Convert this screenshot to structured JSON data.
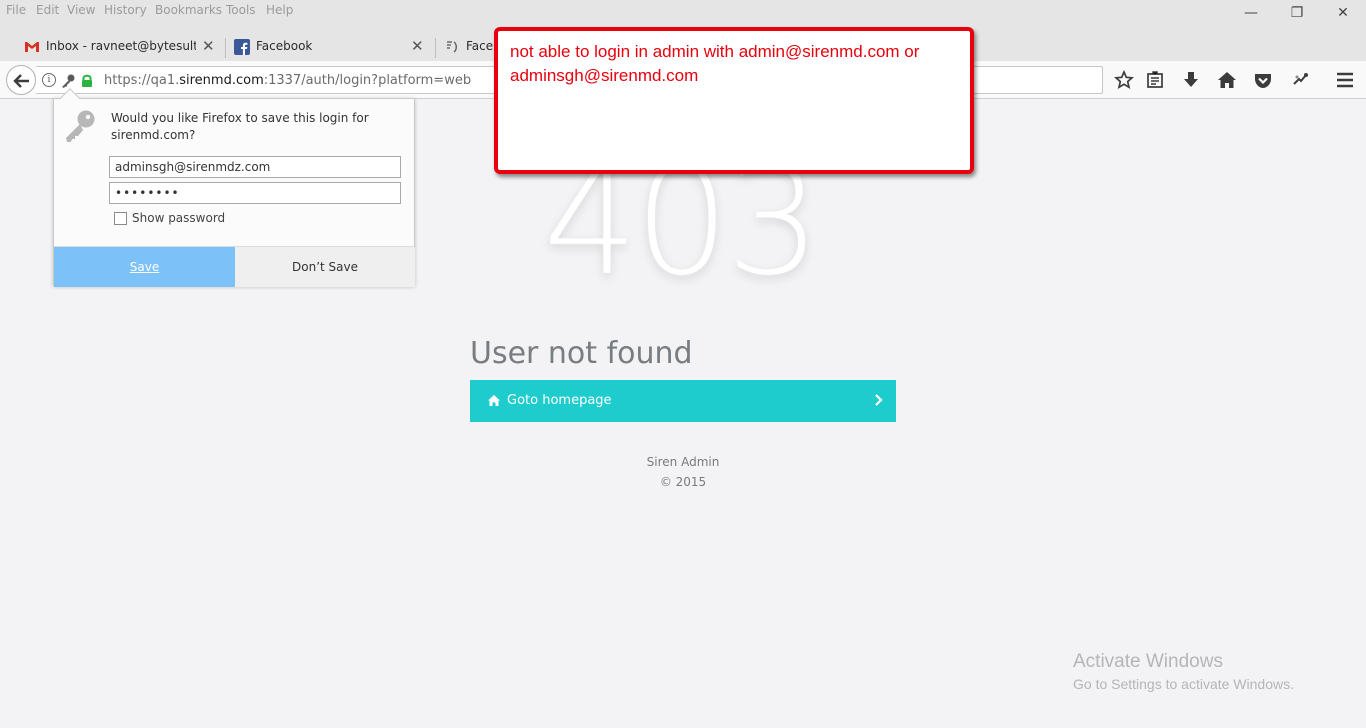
{
  "menu": {
    "items": [
      {
        "label": "File"
      },
      {
        "label": "Edit"
      },
      {
        "label": "View"
      },
      {
        "label": "History"
      },
      {
        "label": "Bookmarks"
      },
      {
        "label": "Tools"
      },
      {
        "label": "Help"
      }
    ]
  },
  "window_controls": {
    "minimize": "—",
    "restore": "❐",
    "close": "✕"
  },
  "tabs": [
    {
      "label": "Inbox - ravneet@bytesultra.c",
      "icon": "gmail-icon"
    },
    {
      "label": "Facebook",
      "icon": "facebook-icon"
    },
    {
      "label": "Face",
      "icon": "loading-icon"
    }
  ],
  "urlbar": {
    "prefix": "https://qa1.",
    "domain": "sirenmd.com",
    "suffix": ":1337/auth/login?platform=web"
  },
  "save_login_popup": {
    "question": "Would you like Firefox to save this login for sirenmd.com?",
    "username": "adminsgh@sirenmdz.com",
    "password": "••••••••",
    "show_password_label": "Show password",
    "save_label": "Save",
    "dont_save_label": "Don’t Save"
  },
  "page": {
    "error_code": "403",
    "error_message": "User not found",
    "goto_label": "Goto homepage",
    "footer_name": "Siren Admin",
    "footer_year": "© 2015"
  },
  "annotation": {
    "text": "not able to login in admin with admin@sirenmd.com or adminsgh@sirenmd.com",
    "color": "#e8000d"
  },
  "watermark": {
    "title": "Activate Windows",
    "subtitle": "Go to Settings to activate Windows."
  },
  "colors": {
    "accent": "#1ecbcd",
    "save_button": "#7cc1f8"
  }
}
